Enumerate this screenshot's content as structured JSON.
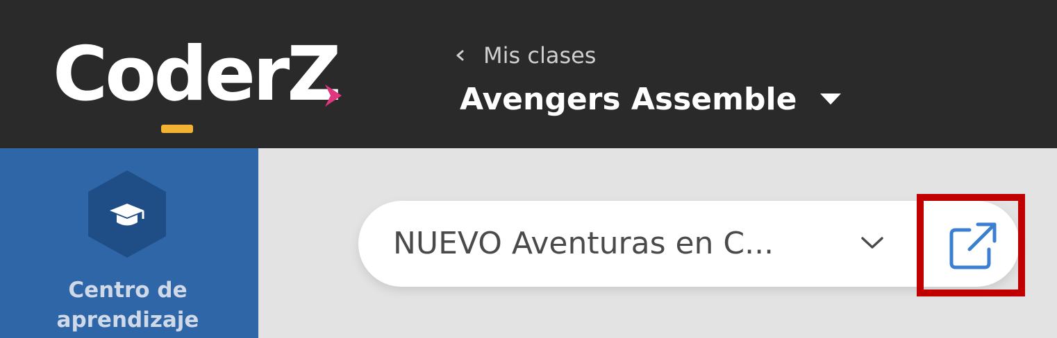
{
  "header": {
    "logo_text": "CoderZ",
    "back_label": "Mis clases",
    "class_name": "Avengers Assemble"
  },
  "sidebar": {
    "item_label": "Centro de aprendizaje",
    "item_icon": "graduation-cap-icon"
  },
  "course": {
    "selected": "NUEVO Aventuras en C...",
    "open_icon": "external-link-icon"
  },
  "colors": {
    "topbar": "#2a2a2a",
    "sidebar": "#2f66a8",
    "accent_yellow": "#f2b233",
    "accent_pink": "#e0357f",
    "link_blue": "#3b7fd0",
    "highlight_red": "#c00000"
  }
}
